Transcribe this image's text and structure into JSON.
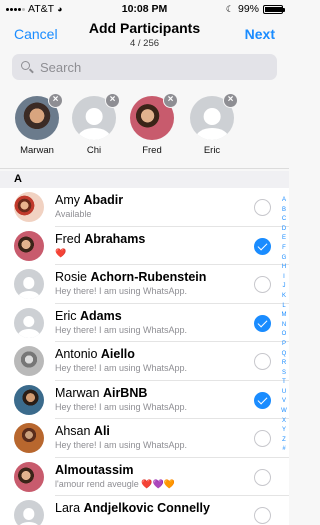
{
  "status": {
    "carrier": "AT&T",
    "time": "10:08 PM",
    "battery": "99%",
    "battery_level": 0.99
  },
  "nav": {
    "cancel": "Cancel",
    "title": "Add Participants",
    "count": "4 / 256",
    "next": "Next"
  },
  "search": {
    "placeholder": "Search"
  },
  "selected": [
    {
      "name": "Marwan",
      "photo": true
    },
    {
      "name": "Chi",
      "photo": false
    },
    {
      "name": "Fred",
      "photo": true
    },
    {
      "name": "Eric",
      "photo": false
    }
  ],
  "section": "A",
  "contacts": [
    {
      "first": "Amy ",
      "last": "Abadir",
      "status": "Available",
      "checked": false
    },
    {
      "first": "Fred ",
      "last": "Abrahams",
      "status": "❤️",
      "checked": true
    },
    {
      "first": "Rosie ",
      "last": "Achorn-Rubenstein",
      "status": "Hey there! I am using WhatsApp.",
      "checked": false
    },
    {
      "first": "Eric  ",
      "last": "Adams",
      "status": "Hey there! I am using WhatsApp.",
      "checked": true
    },
    {
      "first": "Antonio ",
      "last": "Aiello",
      "status": "Hey there! I am using WhatsApp.",
      "checked": false
    },
    {
      "first": "Marwan ",
      "last": "AirBNB",
      "status": "Hey there! I am using WhatsApp.",
      "checked": true
    },
    {
      "first": "Ahsan ",
      "last": "Ali",
      "status": "Hey there! I am using WhatsApp.",
      "checked": false
    },
    {
      "first": "",
      "last": "Almoutassim",
      "status": "l'amour rend aveugle ❤️💜🧡",
      "checked": false
    },
    {
      "first": "Lara ",
      "last": "Andjelkovic Connelly",
      "status": "",
      "checked": false
    }
  ],
  "index_letters": [
    "A",
    "B",
    "C",
    "D",
    "E",
    "F",
    "G",
    "H",
    "I",
    "J",
    "K",
    "L",
    "M",
    "N",
    "O",
    "P",
    "Q",
    "R",
    "S",
    "T",
    "U",
    "V",
    "W",
    "X",
    "Y",
    "Z",
    "#"
  ]
}
